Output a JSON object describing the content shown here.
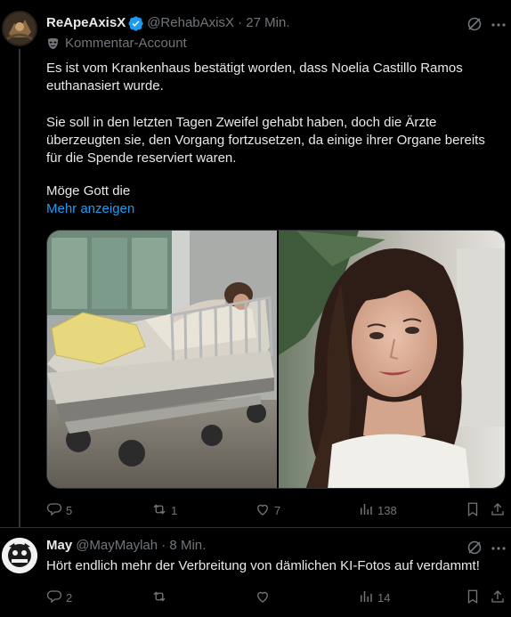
{
  "post1": {
    "author_name": "ReApeAxisX",
    "handle_time": "@RehabAxisX · 27 Min.",
    "account_label": "Kommentar-Account",
    "paragraph1": "Es ist vom  Krankenhaus bestätigt worden, dass Noelia Castillo Ramos euthanasiert wurde.",
    "paragraph2": "Sie soll in den letzten Tagen Zweifel gehabt haben, doch die Ärzte überzeugten sie, den Vorgang fortzusetzen, da einige ihrer Organe bereits für die Spende reserviert waren.",
    "paragraph3": "Möge Gott die",
    "show_more": "Mehr anzeigen",
    "replies": "5",
    "reposts": "1",
    "likes": "7",
    "views": "138"
  },
  "post2": {
    "author_name": "May",
    "handle_time": "@MayMaylah · 8 Min.",
    "text": "Hört endlich mehr der Verbreitung von dämlichen KI-Fotos auf verdammt!",
    "replies": "2",
    "reposts": "",
    "likes": "",
    "views": "14"
  },
  "colors": {
    "background": "#000000",
    "text": "#e7e9ea",
    "muted": "#71767b",
    "link": "#1d9bf0",
    "verified": "#1d9bf0",
    "border": "#2f3336"
  },
  "icons": [
    "verified-badge-icon",
    "grok-icon",
    "more-icon",
    "mask-icon",
    "reply-icon",
    "repost-icon",
    "like-icon",
    "views-icon",
    "bookmark-icon",
    "share-icon"
  ]
}
